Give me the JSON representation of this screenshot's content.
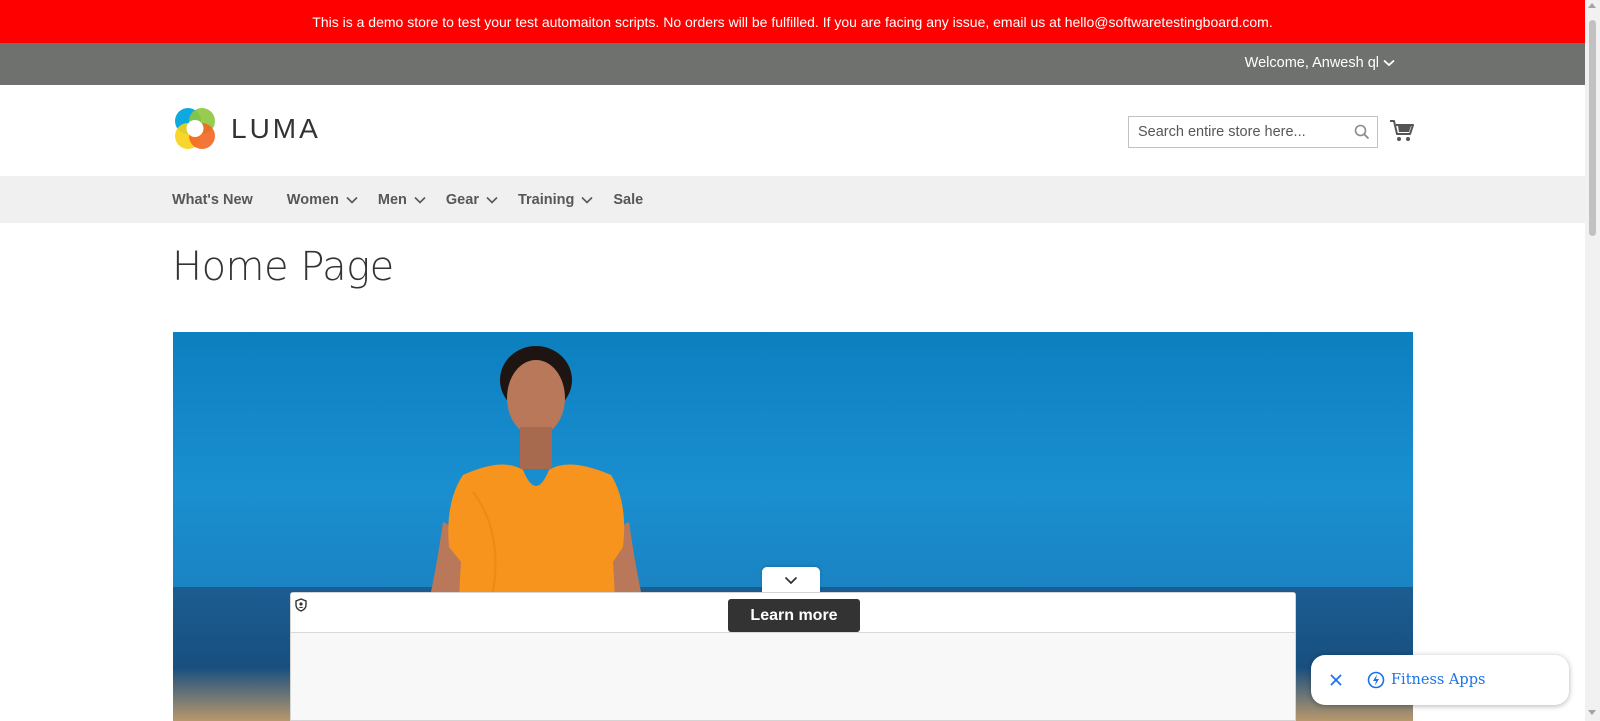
{
  "demo_banner": {
    "text": "This is a demo store to test your test automaiton scripts. No orders will be fulfilled. If you are facing any issue, email us at hello@softwaretestingboard.com."
  },
  "header_panel": {
    "welcome": "Welcome, Anwesh ql"
  },
  "header": {
    "logo_text": "LUMA",
    "search_placeholder": "Search entire store here..."
  },
  "nav": {
    "items": [
      {
        "label": "What's New",
        "has_dropdown": false
      },
      {
        "label": "Women",
        "has_dropdown": true
      },
      {
        "label": "Men",
        "has_dropdown": true
      },
      {
        "label": "Gear",
        "has_dropdown": true
      },
      {
        "label": "Training",
        "has_dropdown": true
      },
      {
        "label": "Sale",
        "has_dropdown": false
      }
    ]
  },
  "page": {
    "title": "Home Page"
  },
  "ad": {
    "learn_more": "Learn more"
  },
  "fitness_chip": {
    "label": "Fitness Apps"
  },
  "colors": {
    "banner_red": "#ff0000",
    "panel_gray": "#6e716e",
    "nav_bg": "#f0f0f0",
    "link_blue": "#1a73e8"
  }
}
